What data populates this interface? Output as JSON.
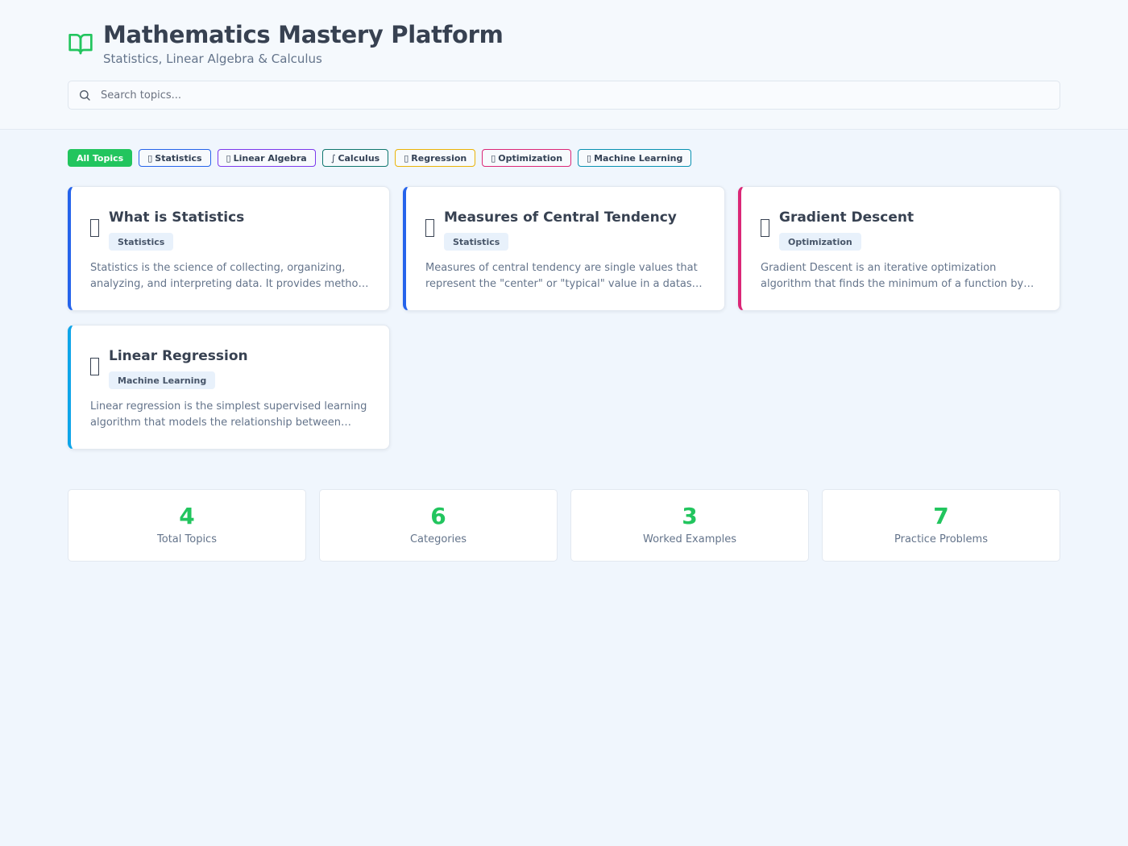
{
  "header": {
    "title": "Mathematics Mastery Platform",
    "subtitle": "Statistics, Linear Algebra & Calculus",
    "icon": "book-open-icon",
    "accent_color": "#22c55e"
  },
  "search": {
    "placeholder": "Search topics...",
    "value": ""
  },
  "filters": [
    {
      "label": "All Topics",
      "glyph": "",
      "active": true,
      "color": "#22c55e"
    },
    {
      "label": "Statistics",
      "glyph": "▯",
      "active": false,
      "color": "#2563eb"
    },
    {
      "label": "Linear Algebra",
      "glyph": "▯",
      "active": false,
      "color": "#7c3aed"
    },
    {
      "label": "Calculus",
      "glyph": "∫",
      "active": false,
      "color": "#0f766e"
    },
    {
      "label": "Regression",
      "glyph": "▯",
      "active": false,
      "color": "#eab308"
    },
    {
      "label": "Optimization",
      "glyph": "▯",
      "active": false,
      "color": "#db2777"
    },
    {
      "label": "Machine Learning",
      "glyph": "▯",
      "active": false,
      "color": "#0891b2"
    }
  ],
  "topics": [
    {
      "title": "What is Statistics",
      "category": "Statistics",
      "description": "Statistics is the science of collecting, organizing, analyzing, and interpreting data. It provides methods for drawing conclusions from data.",
      "accent": "#2563eb"
    },
    {
      "title": "Measures of Central Tendency",
      "category": "Statistics",
      "description": "Measures of central tendency are single values that represent the \"center\" or \"typical\" value in a dataset. The most common are mean, median and mode.",
      "accent": "#2563eb"
    },
    {
      "title": "Gradient Descent",
      "category": "Optimization",
      "description": "Gradient Descent is an iterative optimization algorithm that finds the minimum of a function by moving in the direction of steepest descent.",
      "accent": "#db2777"
    },
    {
      "title": "Linear Regression",
      "category": "Machine Learning",
      "description": "Linear regression is the simplest supervised learning algorithm that models the relationship between inputs and outputs as a straight line.",
      "accent": "#0ea5e9"
    }
  ],
  "stats": [
    {
      "value": "4",
      "label": "Total Topics"
    },
    {
      "value": "6",
      "label": "Categories"
    },
    {
      "value": "3",
      "label": "Worked Examples"
    },
    {
      "value": "7",
      "label": "Practice Problems"
    }
  ]
}
